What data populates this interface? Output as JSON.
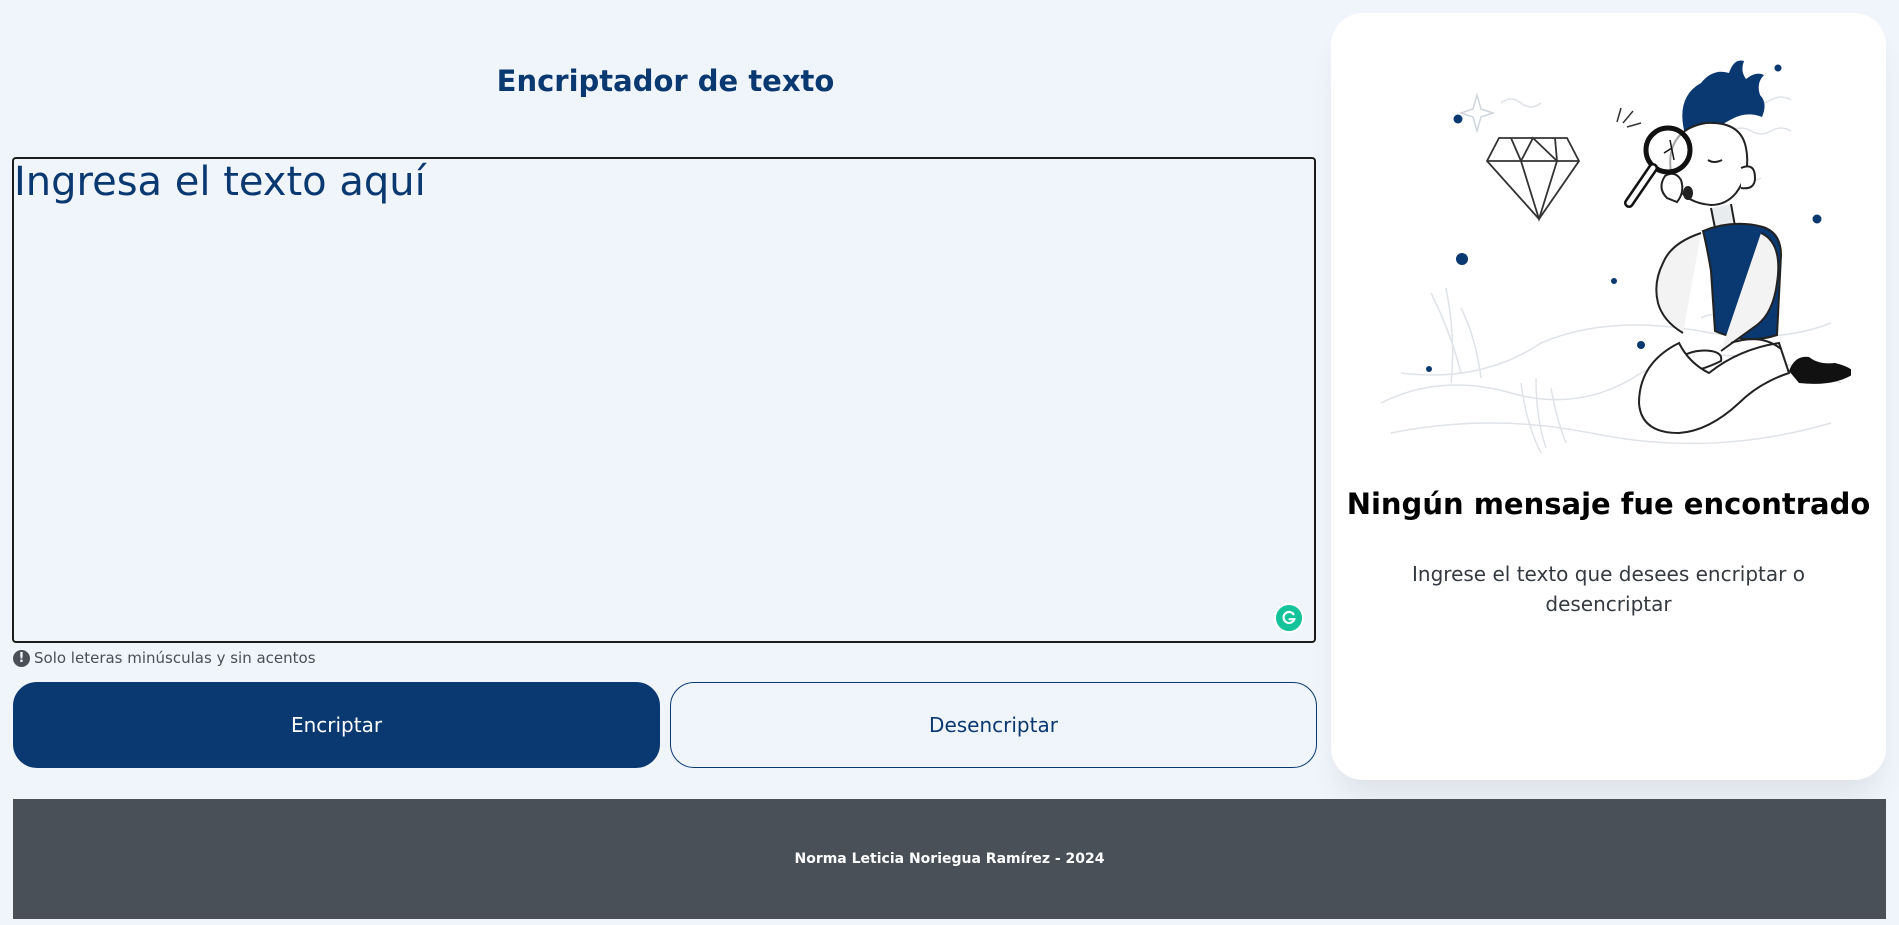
{
  "header": {
    "title": "Encriptador de texto"
  },
  "input": {
    "placeholder": "Ingresa el texto aquí",
    "value": ""
  },
  "hint": {
    "icon": "exclamation-circle-icon",
    "text": "Solo leteras minúsculas y sin acentos"
  },
  "actions": {
    "encrypt_label": "Encriptar",
    "decrypt_label": "Desencriptar"
  },
  "output": {
    "title": "Ningún mensaje fue encontrado",
    "text": "Ingrese el texto que desees encriptar o desencriptar",
    "illustration": "person-with-magnifying-glass-and-diamond"
  },
  "footer": {
    "text": "Norma Leticia Noriegua Ramírez - 2024"
  },
  "colors": {
    "background": "#f0f4fb",
    "primary": "#0a3871",
    "footer": "#495057",
    "card": "#ffffff"
  }
}
